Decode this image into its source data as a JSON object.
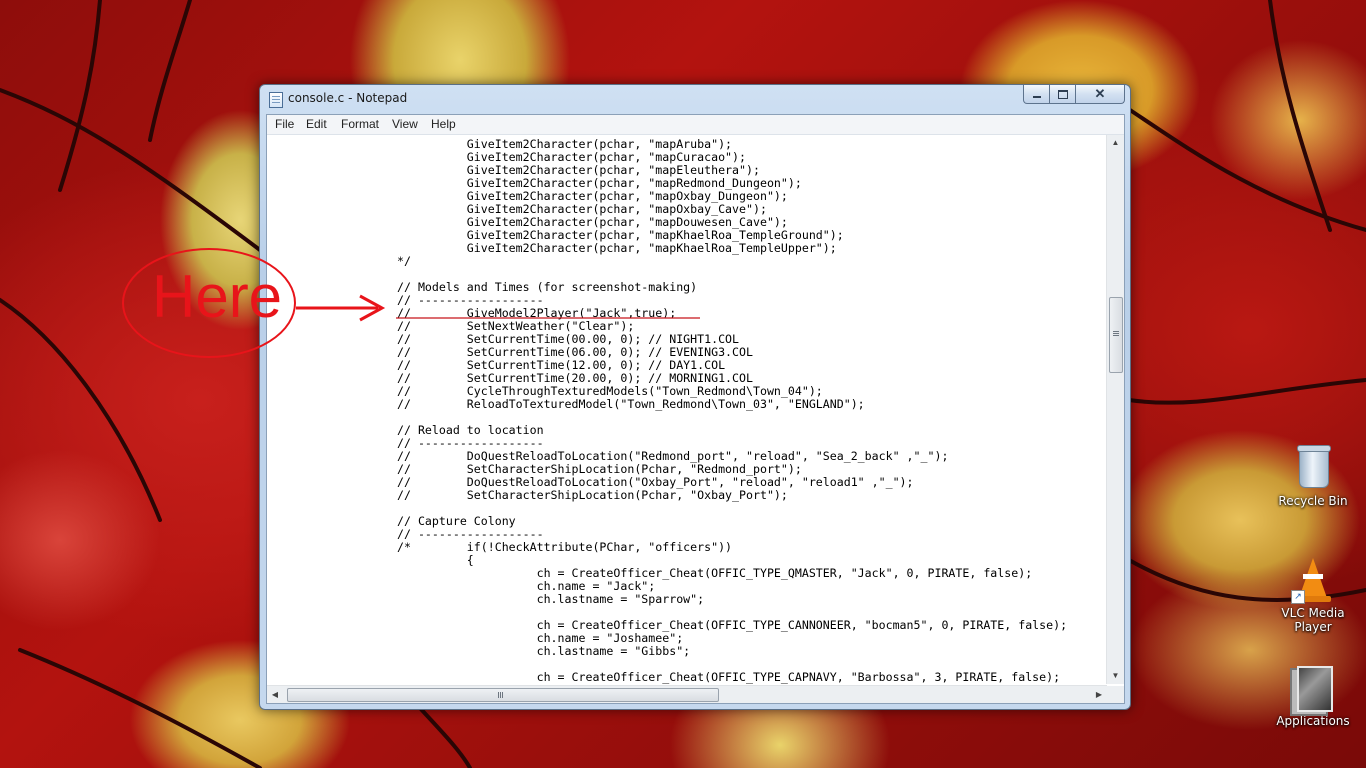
{
  "window": {
    "title": "console.c - Notepad",
    "close_glyph": "✕"
  },
  "menu": {
    "file": "File",
    "edit": "Edit",
    "format": "Format",
    "view": "View",
    "help": "Help"
  },
  "editor": {
    "lines": [
      "          GiveItem2Character(pchar, \"mapAruba\");",
      "          GiveItem2Character(pchar, \"mapCuracao\");",
      "          GiveItem2Character(pchar, \"mapEleuthera\");",
      "          GiveItem2Character(pchar, \"mapRedmond_Dungeon\");",
      "          GiveItem2Character(pchar, \"mapOxbay_Dungeon\");",
      "          GiveItem2Character(pchar, \"mapOxbay_Cave\");",
      "          GiveItem2Character(pchar, \"mapDouwesen_Cave\");",
      "          GiveItem2Character(pchar, \"mapKhaelRoa_TempleGround\");",
      "          GiveItem2Character(pchar, \"mapKhaelRoa_TempleUpper\");",
      "*/",
      "",
      "// Models and Times (for screenshot-making)",
      "// ------------------",
      "//        GiveModel2Player(\"Jack\",true);",
      "//        SetNextWeather(\"Clear\");",
      "//        SetCurrentTime(00.00, 0); // NIGHT1.COL",
      "//        SetCurrentTime(06.00, 0); // EVENING3.COL",
      "//        SetCurrentTime(12.00, 0); // DAY1.COL",
      "//        SetCurrentTime(20.00, 0); // MORNING1.COL",
      "//        CycleThroughTexturedModels(\"Town_Redmond\\Town_04\");",
      "//        ReloadToTexturedModel(\"Town_Redmond\\Town_03\", \"ENGLAND\");",
      "",
      "// Reload to location",
      "// ------------------",
      "//        DoQuestReloadToLocation(\"Redmond_port\", \"reload\", \"Sea_2_back\" ,\"_\");",
      "//        SetCharacterShipLocation(Pchar, \"Redmond_port\");",
      "//        DoQuestReloadToLocation(\"Oxbay_Port\", \"reload\", \"reload1\" ,\"_\");",
      "//        SetCharacterShipLocation(Pchar, \"Oxbay_Port\");",
      "",
      "// Capture Colony",
      "// ------------------",
      "/*        if(!CheckAttribute(PChar, \"officers\"))",
      "          {",
      "                    ch = CreateOfficer_Cheat(OFFIC_TYPE_QMASTER, \"Jack\", 0, PIRATE, false);",
      "                    ch.name = \"Jack\";",
      "                    ch.lastname = \"Sparrow\";",
      "",
      "                    ch = CreateOfficer_Cheat(OFFIC_TYPE_CANNONEER, \"bocman5\", 0, PIRATE, false);",
      "                    ch.name = \"Joshamee\";",
      "                    ch.lastname = \"Gibbs\";",
      "",
      "                    ch = CreateOfficer_Cheat(OFFIC_TYPE_CAPNAVY, \"Barbossa\", 3, PIRATE, false);"
    ]
  },
  "annotation": {
    "text": "Here",
    "color": "#e8141a"
  },
  "desktop_icons": {
    "recycle_bin": "Recycle Bin",
    "vlc_line1": "VLC Media",
    "vlc_line2": "Player",
    "applications": "Applications"
  },
  "icons": {
    "notepad": "notepad-icon",
    "recycle_bin": "recycle-bin-icon",
    "vlc": "vlc-cone-icon",
    "applications": "applications-folder-icon"
  }
}
